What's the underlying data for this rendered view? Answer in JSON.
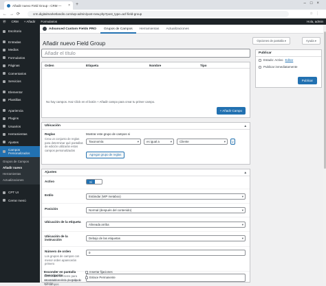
{
  "browser": {
    "tab_title": "Añadir nuevo Field Group ‹ CRM —",
    "url": "crm.digitalmarketlandin.com/wp-admin/post-new.php?post_type=acf-field-group"
  },
  "adminbar": {
    "site": "CRM",
    "new": "Añadir",
    "forms": "Formularios",
    "greeting": "Hola, admin"
  },
  "sidebar": {
    "items": [
      {
        "label": "Escritorio"
      },
      {
        "label": "Entradas"
      },
      {
        "label": "Medios"
      },
      {
        "label": "Formularios"
      },
      {
        "label": "Páginas"
      },
      {
        "label": "Comentarios"
      },
      {
        "label": "Servicios"
      },
      {
        "label": "Elementor"
      },
      {
        "label": "Plantillas"
      },
      {
        "label": "Apariencia"
      },
      {
        "label": "Plugins"
      },
      {
        "label": "Usuarios"
      },
      {
        "label": "Herramientas"
      },
      {
        "label": "Ajustes"
      },
      {
        "label": "Campos Personalizados"
      }
    ],
    "submenu": [
      "Grupos de Campos",
      "Añadir nuevo",
      "Herramientas",
      "Actualizaciones"
    ],
    "after": [
      {
        "label": "CPT UI"
      },
      {
        "label": "Cerrar menú"
      }
    ]
  },
  "acf_header": {
    "title": "Advanced Custom Fields PRO",
    "tabs": [
      "Grupos de Campos",
      "Herramientas",
      "Actualizaciones"
    ]
  },
  "screen_options": "Opciones de pantalla ▾",
  "help": "Ayuda ▾",
  "page_title": "Añadir nuevo Field Group",
  "title_placeholder": "Añadir el título",
  "fields_table": {
    "columns": [
      "Orden",
      "Etiqueta",
      "Nombre",
      "Tipo"
    ],
    "empty": "No hay campos. Haz Click en el botón + Añadir campo para crear tu primer campo.",
    "add_button": "+ Añadir Campo"
  },
  "publish": {
    "title": "Publicar",
    "status_label": "Estado: Activo",
    "status_link": "Editar",
    "publish_time": "Publicar inmediatamente",
    "button": "Publicar"
  },
  "location": {
    "title": "Ubicación",
    "rules_label": "Reglas",
    "rules_desc": "Crea un conjunto de reglas para determinar qué pantallas de edición utilizarán estos campos personalizados",
    "show_if": "Mostrar este grupo de campos si",
    "param": "Taxonomía",
    "operator": "es igual a",
    "value": "Cliente",
    "and": "y",
    "add_group": "Agregar grupo de reglas"
  },
  "settings": {
    "title": "Ajustes",
    "active_label": "Activo",
    "active_value": "Sí",
    "style_label": "Estilo",
    "style_value": "Estándar (WP metabox)",
    "position_label": "Posición",
    "position_value": "Normal (después del contenido)",
    "label_placement_label": "Ubicación de la etiqueta",
    "label_placement_value": "Alineada arriba",
    "instruction_label": "Ubicación de la instrucción",
    "instruction_value": "Debajo de las etiquetas",
    "order_label": "Número de orden",
    "order_desc": "Los grupos de campos con menor orden aparecerán primero",
    "order_value": "0",
    "description_label": "Descripción",
    "description_desc": "Mostrado en lista de grupos de campos",
    "hide_label": "Esconder en pantalla",
    "hide_desc": "Selecciona los ítems para esconderlos en la pantalla de edición",
    "hide_options": [
      "Insertar fijaciones",
      "Enlace Permanente"
    ]
  }
}
